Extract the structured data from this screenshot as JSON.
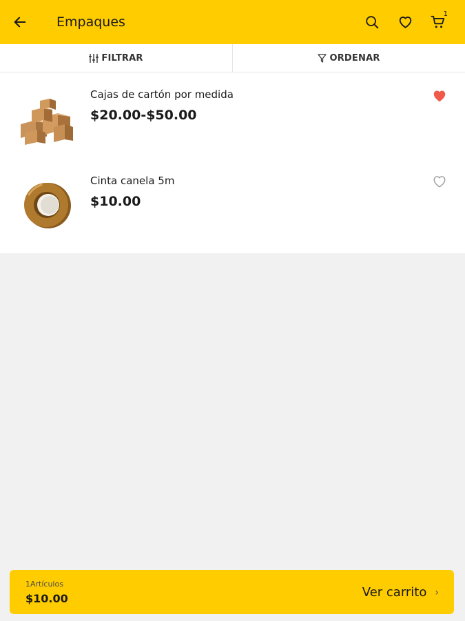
{
  "header": {
    "title": "Empaques",
    "back_icon": "arrow-left-icon",
    "search_icon": "search-icon",
    "favorites_icon": "heart-outline-icon",
    "cart_icon": "cart-icon",
    "cart_badge": "1",
    "background": "#ffcc00"
  },
  "toolbar": {
    "filter_label": "FILTRAR",
    "sort_label": "ORDENAR"
  },
  "products": [
    {
      "name": "Cajas de cartón por medida",
      "price": "$20.00-$50.00",
      "favorited": true,
      "image": "cardboard-boxes-image"
    },
    {
      "name": "Cinta canela 5m",
      "price": "$10.00",
      "favorited": false,
      "image": "packing-tape-image"
    }
  ],
  "cart_bar": {
    "count_label": "1Artículos",
    "total": "$10.00",
    "view_cart_label": "Ver carrito",
    "chevron": "›"
  },
  "colors": {
    "accent": "#ffcc00",
    "favorite": "#f05a4a"
  }
}
